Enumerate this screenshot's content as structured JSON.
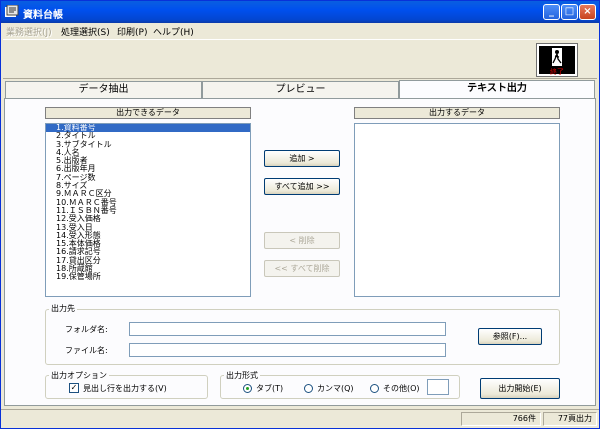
{
  "window": {
    "title": "資料台帳"
  },
  "menu": [
    {
      "label": "業務選択(J)",
      "disabled": true
    },
    {
      "label": "処理選択(S)",
      "disabled": false
    },
    {
      "label": "印刷(P)",
      "disabled": false
    },
    {
      "label": "ヘルプ(H)",
      "disabled": false
    }
  ],
  "toolbar": {
    "exit_label": "終了"
  },
  "tabs": [
    {
      "label": "データ抽出",
      "active": false
    },
    {
      "label": "プレビュー",
      "active": false
    },
    {
      "label": "テキスト出力",
      "active": true
    }
  ],
  "available": {
    "header": "出力できるデータ",
    "items": [
      "1.資料番号",
      "2.タイトル",
      "3.サブタイトル",
      "4.人名",
      "5.出版者",
      "6.出版年月",
      "7.ページ数",
      "8.サイズ",
      "9.ＭＡＲＣ区分",
      "10.ＭＡＲＣ番号",
      "11.ＩＳＢＮ番号",
      "12.受入価格",
      "13.受入日",
      "14.受入形態",
      "15.本体価格",
      "16.請求記号",
      "17.貸出区分",
      "18.所蔵館",
      "19.保管場所"
    ],
    "selected_index": 0
  },
  "output": {
    "header": "出力するデータ"
  },
  "buttons": {
    "add": "追加 >",
    "add_all": "すべて追加 >>",
    "remove": "< 削除",
    "remove_all": "<< すべて削除",
    "browse": "参照(F)...",
    "start": "出力開始(E)"
  },
  "destination": {
    "title": "出力先",
    "folder_label": "フォルダ名:",
    "folder_value": "",
    "file_label": "ファイル名:",
    "file_value": ""
  },
  "options": {
    "title": "出力オプション",
    "header_checkbox": "見出し行を出力する(V)",
    "header_checked": true
  },
  "format": {
    "title": "出力形式",
    "tab": "タブ(T)",
    "comma": "カンマ(Q)",
    "other": "その他(O)",
    "other_value": "",
    "selected": "tab"
  },
  "status": {
    "count": "766件",
    "mode": "77頁出力"
  }
}
